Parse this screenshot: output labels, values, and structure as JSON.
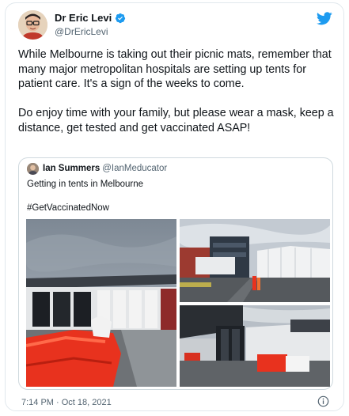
{
  "author": {
    "name": "Dr Eric Levi",
    "handle": "@DrEricLevi",
    "avatar_icon": "doctor-avatar",
    "verified_icon": "verified-badge-icon",
    "verified_color": "#1d9bf0"
  },
  "brand": {
    "icon": "twitter-bird-icon",
    "color": "#1d9bf0"
  },
  "tweet": {
    "paragraph_1": "While Melbourne is taking out their picnic mats, remember that many major metropolitan hospitals are setting up tents for patient care. It's a sign of the weeks to come.",
    "paragraph_2": "Do enjoy time with your family, but please wear a mask, keep a distance, get tested and get vaccinated ASAP!"
  },
  "quoted_tweet": {
    "name": "Ian Summers",
    "handle": "@IanMeducator",
    "text": "Getting in tents in Melbourne",
    "hashtag": "#GetVaccinatedNow"
  },
  "footer": {
    "timestamp": "7:14 PM · Oct 18, 2021",
    "info_icon": "info-icon"
  }
}
